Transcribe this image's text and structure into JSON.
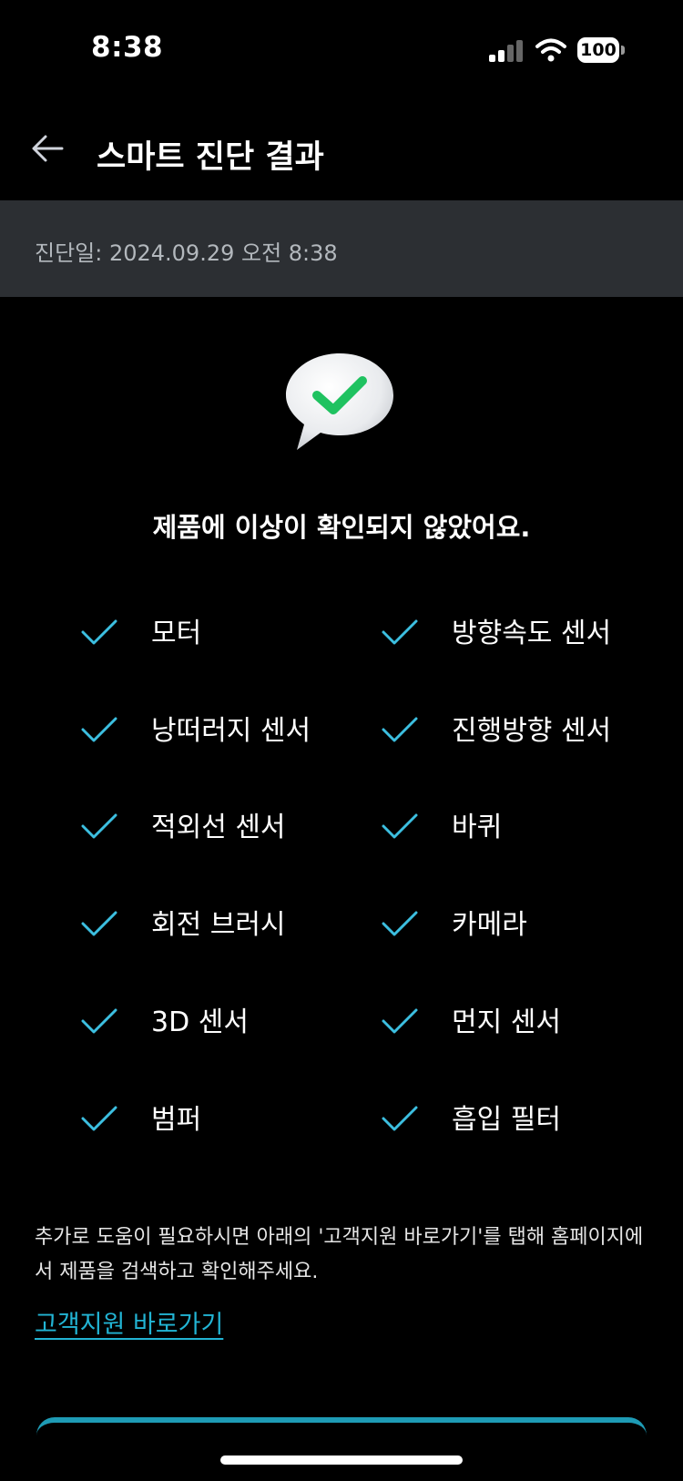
{
  "status_bar": {
    "time": "8:38",
    "battery": "100"
  },
  "header": {
    "title": "스마트 진단 결과"
  },
  "diagnosis": {
    "date": "진단일: 2024.09.29 오전 8:38"
  },
  "result": {
    "message": "제품에 이상이 확인되지 않았어요."
  },
  "checks": [
    {
      "label": "모터"
    },
    {
      "label": "방향속도 센서"
    },
    {
      "label": "낭떠러지 센서"
    },
    {
      "label": "진행방향 센서"
    },
    {
      "label": "적외선 센서"
    },
    {
      "label": "바퀴"
    },
    {
      "label": "회전 브러시"
    },
    {
      "label": "카메라"
    },
    {
      "label": "3D 센서"
    },
    {
      "label": "먼지 센서"
    },
    {
      "label": "범퍼"
    },
    {
      "label": "흡입 필터"
    }
  ],
  "help": {
    "text": "추가로 도움이 필요하시면 아래의 '고객지원 바로가기'를 탭해 홈페이지에서 제품을 검색하고 확인해주세요.",
    "link_label": "고객지원 바로가기"
  },
  "colors": {
    "accent": "#22b4d4",
    "check": "#3cbfe0",
    "success": "#22c55e",
    "date_bar": "#2c2f33"
  },
  "icons": {
    "back": "arrow-left-icon",
    "result": "speech-bubble-check-icon",
    "check": "checkmark-icon"
  }
}
